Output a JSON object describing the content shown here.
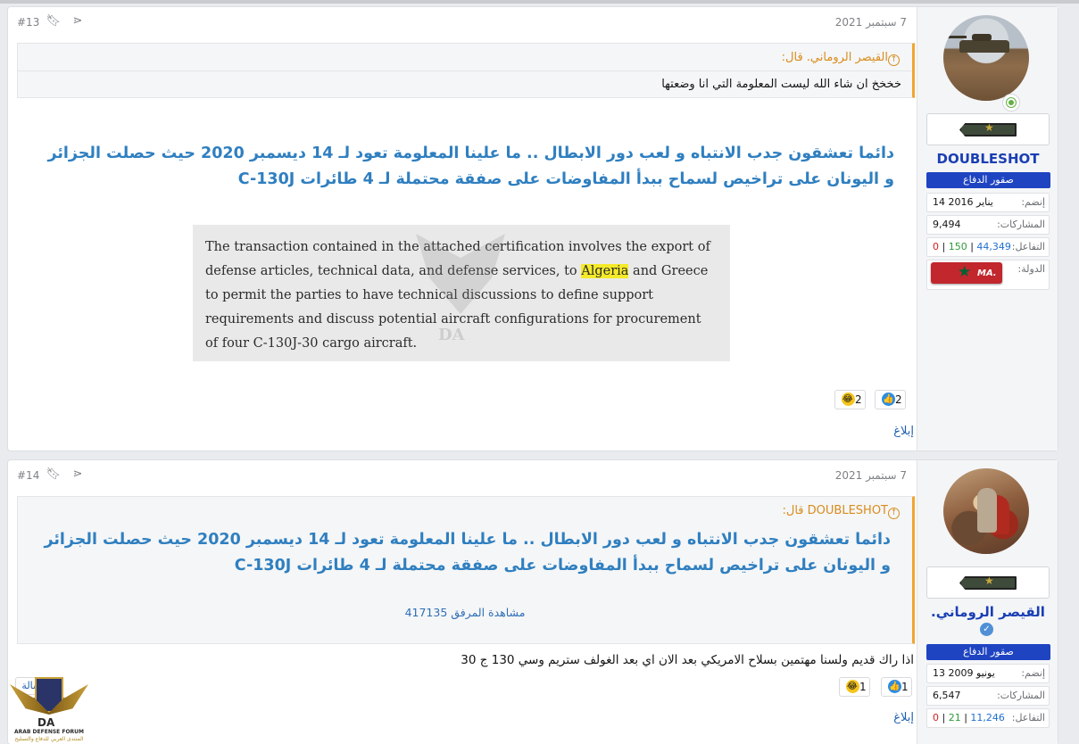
{
  "posts": [
    {
      "date": "7 سبتمبر 2021",
      "number": "#13",
      "user": {
        "name": "DOUBLESHOT",
        "badge": "صقور الدفاع",
        "joined_label": "إنضم:",
        "joined": "14 يناير 2016",
        "posts_label": "المشاركات:",
        "posts": "9,494",
        "reactions_label": "التفاعل:",
        "reactions_pos": "44,349",
        "reactions_mid": "150",
        "reactions_neg": "0",
        "country_label": "الدولة:",
        "flag_code": ".MA"
      },
      "quote": {
        "author": "القيصر الروماني. قال:",
        "text": "خخخخ ان شاء الله ليست المعلومة التي انا وضعتها"
      },
      "headline": "دائما تعشقون جدب الانتباه و لعب دور الابطال .. ما علينا المعلومة تعود لـ 14 ديسمبر 2020 حيث حصلت الجزائر و اليونان على تراخيص لسماح ببدأ المفاوضات على صفقة محتملة لـ 4 طائرات C-130J",
      "excerpt": {
        "before": "The transaction contained in the attached certification involves the export of defense articles, technical data, and defense services, to ",
        "highlight": "Algeria",
        "after": " and Greece to permit the parties to have technical discussions to define support requirements and discuss potential aircraft configurations for procurement of four C-130J-30 cargo aircraft."
      },
      "reactions": {
        "like": "2",
        "laugh": "2"
      },
      "report": "إبلاغ"
    },
    {
      "date": "7 سبتمبر 2021",
      "number": "#14",
      "user": {
        "name": "القيصر الروماني.",
        "badge": "صقور الدفاع",
        "joined_label": "إنضم:",
        "joined": "13 يونيو 2009",
        "posts_label": "المشاركات:",
        "posts": "6,547",
        "reactions_label": "التفاعل:",
        "reactions_pos": "11,246",
        "reactions_mid": "21",
        "reactions_neg": "0"
      },
      "quote": {
        "author": "DOUBLESHOT قال:",
        "text": "دائما تعشقون جدب الانتباه و لعب دور الابطال .. ما علينا المعلومة تعود لـ 14 ديسمبر 2020 حيث حصلت الجزائر و اليونان على تراخيص لسماح ببدأ المفاوضات على صفقة محتملة لـ 4 طائرات C-130J",
        "attachment": "مشاهدة المرفق 417135"
      },
      "reply": "اذا راك قديم ولسنا مهتمين بسلاح الامريكي بعد الان اي بعد الغولف ستريم وسي 130 ج 30",
      "reactions": {
        "like": "1",
        "laugh": "1"
      },
      "report": "إبلاغ"
    }
  ],
  "watermark": {
    "mark": "DA"
  },
  "logo": {
    "mark": "DA",
    "name": "ARAB DEFENSE FORUM",
    "subtitle": "المنتدى العربي للدفاع والتسليح",
    "tag": "رسالة"
  },
  "icons": [
    "bookmark-icon",
    "share-icon",
    "quote-arrow-icon",
    "like-icon",
    "laugh-icon",
    "verified-icon",
    "online-status-icon"
  ],
  "colors": {
    "accent": "#2f7fc0",
    "quote_border": "#f2a431",
    "badge": "#1f44c2",
    "username": "#1a3fb3"
  }
}
